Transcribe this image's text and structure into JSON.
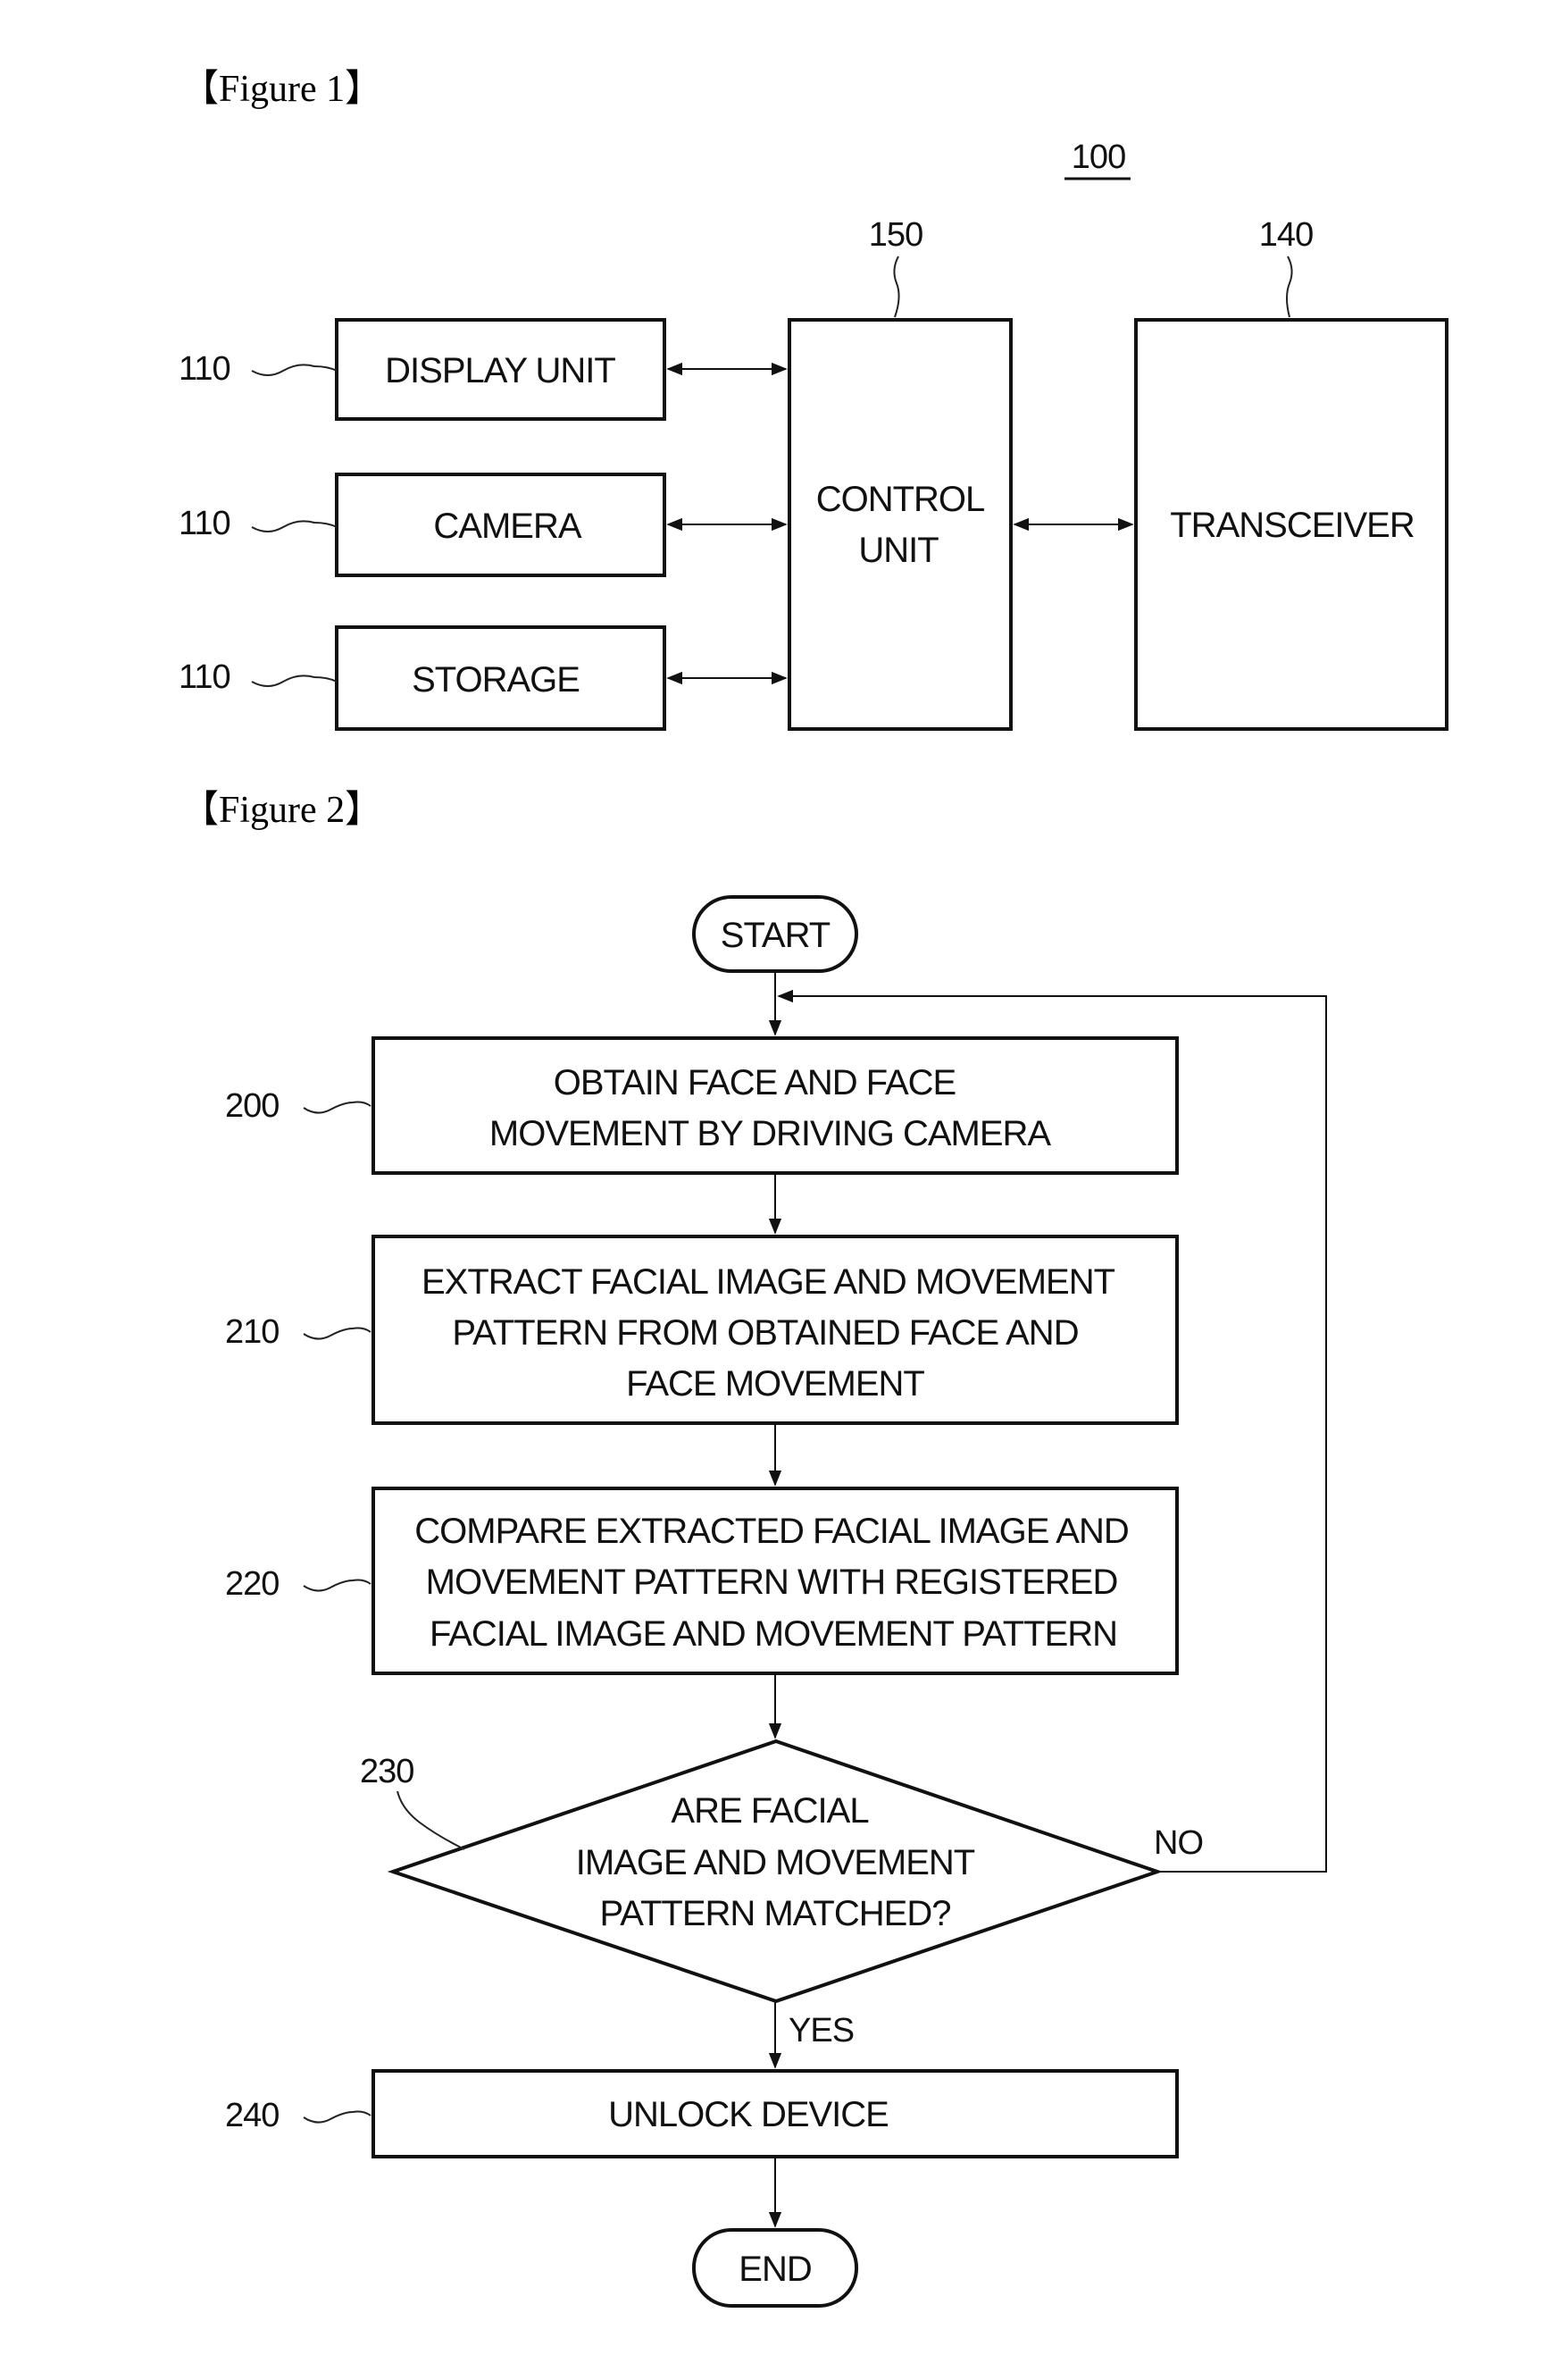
{
  "figure1": {
    "label": "【Figure 1】",
    "device_ref": "100",
    "blocks": [
      {
        "id": "display",
        "ref": "110",
        "lines": [
          "DISPLAY UNIT"
        ]
      },
      {
        "id": "camera",
        "ref": "110",
        "lines": [
          "CAMERA"
        ]
      },
      {
        "id": "storage",
        "ref": "110",
        "lines": [
          "STORAGE"
        ]
      },
      {
        "id": "control",
        "ref": "150",
        "lines": [
          "CONTROL",
          "UNIT"
        ]
      },
      {
        "id": "transceiver",
        "ref": "140",
        "lines": [
          "TRANSCEIVER"
        ]
      }
    ],
    "connections": [
      {
        "from": "display",
        "to": "control",
        "bidirectional": true
      },
      {
        "from": "camera",
        "to": "control",
        "bidirectional": true
      },
      {
        "from": "storage",
        "to": "control",
        "bidirectional": true
      },
      {
        "from": "control",
        "to": "transceiver",
        "bidirectional": true
      }
    ]
  },
  "figure2": {
    "label": "【Figure 2】",
    "start": "START",
    "end": "END",
    "steps": [
      {
        "ref": "200",
        "lines": [
          "OBTAIN FACE AND FACE",
          "MOVEMENT BY DRIVING CAMERA"
        ]
      },
      {
        "ref": "210",
        "lines": [
          "EXTRACT FACIAL IMAGE AND MOVEMENT",
          "PATTERN FROM OBTAINED FACE AND",
          "FACE MOVEMENT"
        ]
      },
      {
        "ref": "220",
        "lines": [
          "COMPARE EXTRACTED FACIAL IMAGE AND",
          "MOVEMENT PATTERN WITH REGISTERED",
          "FACIAL IMAGE AND MOVEMENT PATTERN"
        ]
      }
    ],
    "decision": {
      "ref": "230",
      "lines": [
        "ARE FACIAL",
        "IMAGE AND MOVEMENT",
        "PATTERN MATCHED?"
      ],
      "yes_label": "YES",
      "no_label": "NO"
    },
    "final_step": {
      "ref": "240",
      "lines": [
        "UNLOCK DEVICE"
      ]
    }
  }
}
